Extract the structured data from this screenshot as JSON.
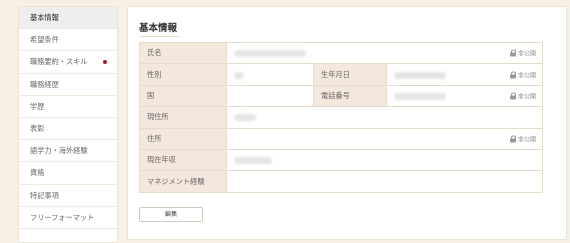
{
  "sidebar": {
    "items": [
      {
        "label": "基本情報",
        "active": true
      },
      {
        "label": "希望条件"
      },
      {
        "label": "職務要約・スキル",
        "has_alert": true
      },
      {
        "label": "職務経歴"
      },
      {
        "label": "学歴"
      },
      {
        "label": "表彰"
      },
      {
        "label": "語学力・海外経験"
      },
      {
        "label": "資格"
      },
      {
        "label": "特記事項"
      },
      {
        "label": "フリーフォーマット"
      }
    ]
  },
  "main": {
    "title": "基本情報",
    "private_label": "非公開",
    "fields": {
      "name": "氏名",
      "gender": "性別",
      "birth": "生年月日",
      "country": "国",
      "phone": "電話番号",
      "current_address": "現住所",
      "address": "住所",
      "income": "現在年収",
      "management": "マネジメント経験"
    },
    "edit_button": "編集"
  },
  "colors": {
    "accent_dot": "#a31f2b",
    "label_bg": "#f4e7dc",
    "page_bg": "#f7f1e4"
  }
}
